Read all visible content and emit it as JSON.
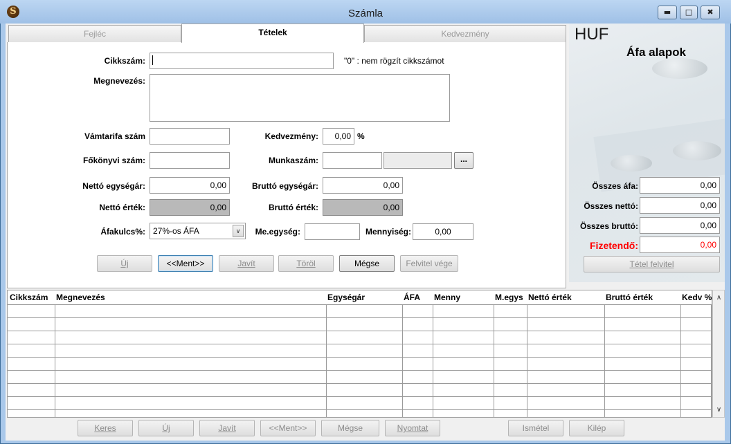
{
  "window": {
    "title": "Számla",
    "app_icon": "app-logo-icon"
  },
  "tabs": [
    {
      "label": "Fejléc",
      "active": false
    },
    {
      "label": "Tételek",
      "active": true
    },
    {
      "label": "Kedvezmény",
      "active": false
    }
  ],
  "form": {
    "cikkszam_label": "Cikkszám:",
    "cikkszam_value": "",
    "cikkszam_hint": "\"0\" : nem rögzít cikkszámot",
    "megnevezes_label": "Megnevezés:",
    "megnevezes_value": "",
    "vamtarifa_label": "Vámtarifa szám",
    "vamtarifa_value": "",
    "kedvezmeny_label": "Kedvezmény:",
    "kedvezmeny_value": "0,00",
    "kedvezmeny_unit": "%",
    "fokonyvi_label": "Főkönyvi szám:",
    "fokonyvi_value": "",
    "munkaszam_label": "Munkaszám:",
    "munkaszam_value": "",
    "munkaszam_desc": "",
    "munkaszam_browse": "...",
    "netto_egysegar_label": "Nettó egységár:",
    "netto_egysegar_value": "0,00",
    "brutto_egysegar_label": "Bruttó egységár:",
    "brutto_egysegar_value": "0,00",
    "netto_ertek_label": "Nettó érték:",
    "netto_ertek_value": "0,00",
    "brutto_ertek_label": "Bruttó érték:",
    "brutto_ertek_value": "0,00",
    "afakulcs_label": "Áfakulcs%:",
    "afakulcs_value": "27%-os ÁFA",
    "meegyseg_label": "Me.egység:",
    "meegyseg_value": "",
    "mennyiseg_label": "Mennyiség:",
    "mennyiseg_value": "0,00"
  },
  "form_buttons": {
    "uj": "Új",
    "ment": "<<Ment>>",
    "javit": "Javít",
    "torol": "Töröl",
    "megse": "Mégse",
    "felvitel_vege": "Felvitel vége"
  },
  "side": {
    "currency": "HUF",
    "title": "Áfa alapok",
    "osszes_afa_label": "Összes áfa:",
    "osszes_afa_value": "0,00",
    "osszes_netto_label": "Összes nettó:",
    "osszes_netto_value": "0,00",
    "osszes_brutto_label": "Összes bruttó:",
    "osszes_brutto_value": "0,00",
    "fizetendo_label": "Fizetendő:",
    "fizetendo_value": "0,00",
    "tetel_felvitel": "Tétel felvitel",
    "accent_red": "#ff0000"
  },
  "grid": {
    "columns": [
      "Cikkszám",
      "Megnevezés",
      "Egységár",
      "ÁFA",
      "Menny",
      "M.egys",
      "Nettó érték",
      "Bruttó érték",
      "Kedv %"
    ]
  },
  "bottom_buttons": {
    "keres": "Keres",
    "uj": "Új",
    "javit": "Javít",
    "ment": "<<Ment>>",
    "megse": "Mégse",
    "nyomtat": "Nyomtat",
    "ismetel": "Ismétel",
    "kilep": "Kilép"
  }
}
